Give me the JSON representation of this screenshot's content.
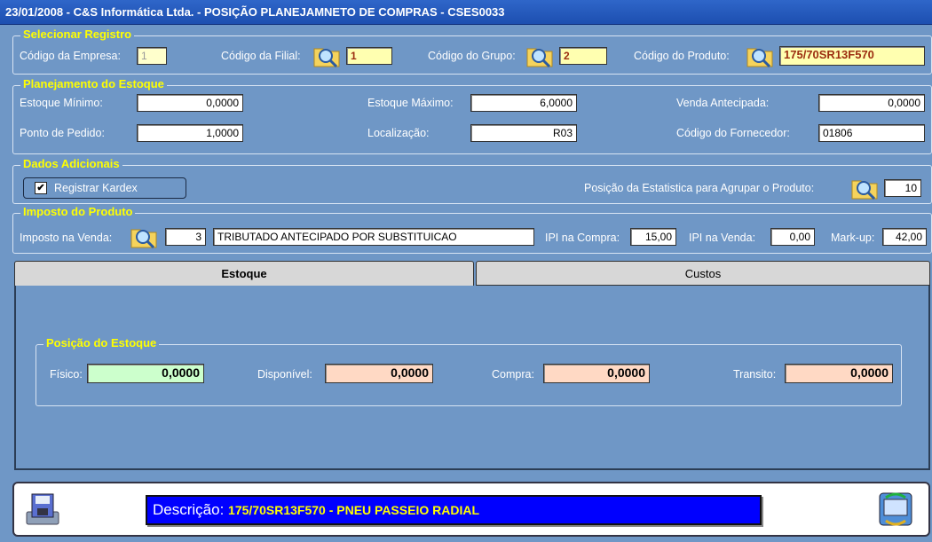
{
  "title": "23/01/2008 - C&S Informática Ltda. - POSIÇÃO PLANEJAMNETO DE COMPRAS - CSES0033",
  "selecionar": {
    "legend": "Selecionar Registro",
    "empresa_label": "Código da Empresa:",
    "empresa_value": "1",
    "filial_label": "Código da Filial:",
    "filial_value": "1",
    "grupo_label": "Código do Grupo:",
    "grupo_value": "2",
    "produto_label": "Código do Produto:",
    "produto_value": "175/70SR13F570"
  },
  "planejamento": {
    "legend": "Planejamento do Estoque",
    "minimo_label": "Estoque Mínimo:",
    "minimo_value": "0,0000",
    "maximo_label": "Estoque Máximo:",
    "maximo_value": "6,0000",
    "venda_ant_label": "Venda Antecipada:",
    "venda_ant_value": "0,0000",
    "ponto_label": "Ponto de Pedido:",
    "ponto_value": "1,0000",
    "localizacao_label": "Localização:",
    "localizacao_value": "R03",
    "fornecedor_label": "Código do  Fornecedor:",
    "fornecedor_value": "01806"
  },
  "adicionais": {
    "legend": "Dados Adicionais",
    "kardex_label": "Registrar Kardex",
    "kardex_checked": true,
    "estatistica_label": "Posição da Estatistica para Agrupar o Produto:",
    "estatistica_value": "10"
  },
  "imposto": {
    "legend": "Imposto do Produto",
    "venda_label": "Imposto na Venda:",
    "codigo_value": "3",
    "descricao_value": "TRIBUTADO ANTECIPADO POR SUBSTITUICAO",
    "ipi_compra_label": "IPI na Compra:",
    "ipi_compra_value": "15,00",
    "ipi_venda_label": "IPI na Venda:",
    "ipi_venda_value": "0,00",
    "markup_label": "Mark-up:",
    "markup_value": "42,00"
  },
  "tabs": {
    "estoque": "Estoque",
    "custos": "Custos"
  },
  "posicao": {
    "legend": "Posição do Estoque",
    "fisico_label": "Físico:",
    "fisico_value": "0,0000",
    "disponivel_label": "Disponível:",
    "disponivel_value": "0,0000",
    "compra_label": "Compra:",
    "compra_value": "0,0000",
    "transito_label": "Transito:",
    "transito_value": "0,0000"
  },
  "descricao": {
    "label": "Descrição:",
    "value": "175/70SR13F570 - PNEU PASSEIO RADIAL"
  },
  "colors": {
    "background": "#6f97c6",
    "legend": "#ffff00",
    "fisico_bg": "#ccffcc",
    "disponivel_bg": "#ffd9c4",
    "descricao_bg": "#0000ff"
  }
}
